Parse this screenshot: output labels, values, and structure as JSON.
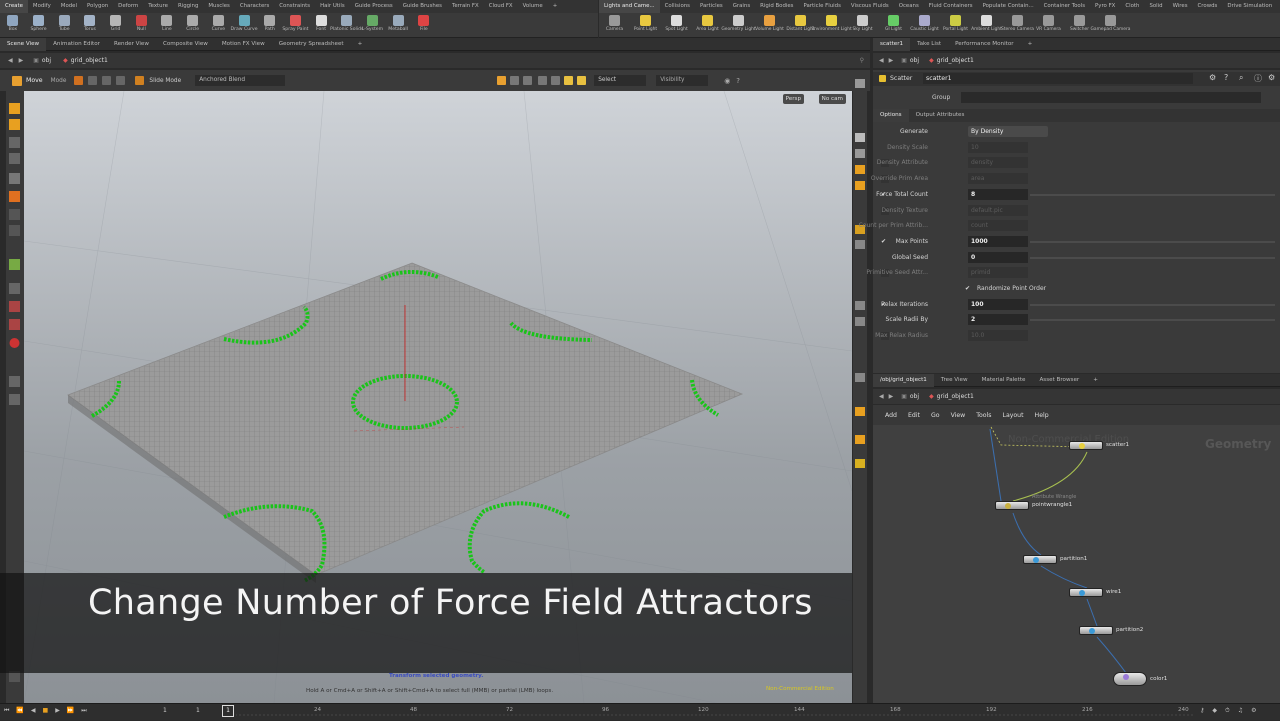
{
  "shelf_left": {
    "tabs": [
      "Create",
      "Modify",
      "Model",
      "Polygon",
      "Deform",
      "Texture",
      "Rigging",
      "Muscles",
      "Characters",
      "Constraints",
      "Hair Utils",
      "Guide Process",
      "Guide Brushes",
      "Terrain FX",
      "Cloud FX",
      "Volume",
      "+"
    ],
    "tools": [
      {
        "label": "Box",
        "icon": "box-icon",
        "color": "#8fa6c0"
      },
      {
        "label": "Sphere",
        "icon": "sphere-icon",
        "color": "#9bb0c8"
      },
      {
        "label": "Tube",
        "icon": "tube-icon",
        "color": "#9aa9bc"
      },
      {
        "label": "Torus",
        "icon": "torus-icon",
        "color": "#a3b3c7"
      },
      {
        "label": "Grid",
        "icon": "grid-icon",
        "color": "#b6b6b6"
      },
      {
        "label": "Null",
        "icon": "null-icon",
        "color": "#c44"
      },
      {
        "label": "Line",
        "icon": "line-icon",
        "color": "#aaa"
      },
      {
        "label": "Circle",
        "icon": "circle-icon",
        "color": "#aaa"
      },
      {
        "label": "Curve",
        "icon": "curve-icon",
        "color": "#aaa"
      },
      {
        "label": "Draw Curve",
        "icon": "draw-curve-icon",
        "color": "#6ab"
      },
      {
        "label": "Path",
        "icon": "path-icon",
        "color": "#aaa"
      },
      {
        "label": "Spray Paint",
        "icon": "spray-paint-icon",
        "color": "#d55"
      },
      {
        "label": "Font",
        "icon": "font-icon",
        "color": "#ddd"
      },
      {
        "label": "Platonic Solids",
        "icon": "platonic-icon",
        "color": "#9ab"
      },
      {
        "label": "L-System",
        "icon": "l-system-icon",
        "color": "#6a6"
      },
      {
        "label": "Metaball",
        "icon": "metaball-icon",
        "color": "#9ab"
      },
      {
        "label": "File",
        "icon": "file-icon",
        "color": "#d44"
      }
    ]
  },
  "shelf_right": {
    "tabs": [
      "Lights and Came...",
      "Collisions",
      "Particles",
      "Grains",
      "Rigid Bodies",
      "Particle Fluids",
      "Viscous Fluids",
      "Oceans",
      "Fluid Containers",
      "Populate Contain...",
      "Container Tools",
      "Pyro FX",
      "Cloth",
      "Solid",
      "Wires",
      "Crowds",
      "Drive Simulation"
    ],
    "tools": [
      {
        "label": "Camera",
        "icon": "camera-icon",
        "color": "#999"
      },
      {
        "label": "Point Light",
        "icon": "point-light-icon",
        "color": "#e8c840"
      },
      {
        "label": "Spot Light",
        "icon": "spot-light-icon",
        "color": "#ddd"
      },
      {
        "label": "Area Light",
        "icon": "area-light-icon",
        "color": "#e8c840"
      },
      {
        "label": "Geometry Light",
        "icon": "geometry-light-icon",
        "color": "#ccc"
      },
      {
        "label": "Volume Light",
        "icon": "volume-light-icon",
        "color": "#e8a040"
      },
      {
        "label": "Distant Light",
        "icon": "distant-light-icon",
        "color": "#e8c840"
      },
      {
        "label": "Environment Light",
        "icon": "environment-light-icon",
        "color": "#e8d040"
      },
      {
        "label": "Sky Light",
        "icon": "sky-light-icon",
        "color": "#ccc"
      },
      {
        "label": "GI Light",
        "icon": "gi-light-icon",
        "color": "#6c6"
      },
      {
        "label": "Caustic Light",
        "icon": "caustic-light-icon",
        "color": "#aac"
      },
      {
        "label": "Portal Light",
        "icon": "portal-light-icon",
        "color": "#cc4"
      },
      {
        "label": "Ambient Light",
        "icon": "ambient-light-icon",
        "color": "#ddd"
      },
      {
        "label": "Stereo Camera",
        "icon": "stereo-camera-icon",
        "color": "#999"
      },
      {
        "label": "VR Camera",
        "icon": "vr-camera-icon",
        "color": "#999"
      },
      {
        "label": "Switcher",
        "icon": "switcher-icon",
        "color": "#999"
      },
      {
        "label": "Gamepad Camera",
        "icon": "gamepad-camera-icon",
        "color": "#999"
      }
    ]
  },
  "viewport_panel": {
    "tabs": [
      "Scene View",
      "Animation Editor",
      "Render View",
      "Composite View",
      "Motion FX View",
      "Geometry Spreadsheet",
      "+"
    ],
    "path_obj": "obj",
    "path_node": "grid_object1",
    "tool_name": "Move",
    "mode_label": "Mode",
    "slide_mode": "Slide Mode",
    "anchored_blend": "Anchored Blend",
    "select_label": "Select",
    "visibility_label": "Visibility",
    "persp_btn": "Persp",
    "cam_btn": "No cam",
    "status_line1": "Transform selected geometry.",
    "status_line2": "Hold A or Cmd+A or Shift+A or Shift+Cmd+A to select full (MMB) or partial (LMB) loops.",
    "watermark": "Non-Commercial Edition"
  },
  "caption": "Change Number of Force Field Attractors",
  "params_panel": {
    "tabs": [
      "scatter1",
      "Take List",
      "Performance Monitor",
      "+"
    ],
    "path_obj": "obj",
    "path_node": "grid_object1",
    "node_type": "Scatter",
    "node_name": "scatter1",
    "group_label": "Group",
    "subtabs": [
      "Options",
      "Output Attributes"
    ],
    "rows": [
      {
        "label": "Generate",
        "value": "By Density",
        "dim": false,
        "check": "none",
        "slider": false
      },
      {
        "label": "Density Scale",
        "value": "10",
        "dim": true,
        "check": "none",
        "slider": false
      },
      {
        "label": "Density Attribute",
        "value": "density",
        "dim": true,
        "check": "empty",
        "slider": false
      },
      {
        "label": "Override Prim Area",
        "value": "area",
        "dim": true,
        "check": "empty",
        "slider": false
      },
      {
        "label": "Force Total Count",
        "value": "8",
        "dim": false,
        "check": "on",
        "slider": true
      },
      {
        "label": "Density Texture",
        "value": "default.pic",
        "dim": true,
        "check": "empty",
        "slider": false
      },
      {
        "label": "Count per Prim Attrib...",
        "value": "count",
        "dim": true,
        "check": "none",
        "slider": false
      },
      {
        "label": "Max Points",
        "value": "1000",
        "dim": false,
        "check": "on",
        "slider": true
      },
      {
        "label": "Global Seed",
        "value": "0",
        "dim": false,
        "check": "none",
        "slider": true
      },
      {
        "label": "Primitive Seed Attr...",
        "value": "primid",
        "dim": true,
        "check": "empty",
        "slider": false
      },
      {
        "label": "Randomize Point Order",
        "value": "",
        "dim": false,
        "check": "toggle",
        "slider": false
      },
      {
        "label": "Relax Iterations",
        "value": "100",
        "dim": false,
        "check": "on",
        "slider": true
      },
      {
        "label": "Scale Radii By",
        "value": "2",
        "dim": false,
        "check": "none",
        "slider": true
      },
      {
        "label": "Max Relax Radius",
        "value": "10.0",
        "dim": true,
        "check": "empty",
        "slider": false
      }
    ]
  },
  "network_panel": {
    "tabs": [
      "/obj/grid_object1",
      "Tree View",
      "Material Palette",
      "Asset Browser",
      "+"
    ],
    "path_obj": "obj",
    "path_node": "grid_object1",
    "menu": [
      "Add",
      "Edit",
      "Go",
      "View",
      "Tools",
      "Layout",
      "Help"
    ],
    "watermark": "Non-Commercial Edition",
    "context_label": "Geometry",
    "nodes": [
      {
        "name": "scatter1",
        "sub": "",
        "color": "#e8d040"
      },
      {
        "name": "pointwrangle1",
        "sub": "Attribute Wrangle",
        "color": "#c8b040"
      },
      {
        "name": "partition1",
        "sub": "",
        "color": "#3a9ad8"
      },
      {
        "name": "wire1",
        "sub": "",
        "color": "#3a9ad8"
      },
      {
        "name": "partition2",
        "sub": "",
        "color": "#3a9ad8"
      },
      {
        "name": "color1",
        "sub": "",
        "color": "#9a7ad8"
      }
    ]
  },
  "timeline": {
    "start_frame": "1",
    "current_frame": "1",
    "ticks": [
      "24",
      "48",
      "72",
      "96",
      "120",
      "144",
      "168",
      "192",
      "216",
      "240"
    ],
    "end_frame": "240"
  }
}
